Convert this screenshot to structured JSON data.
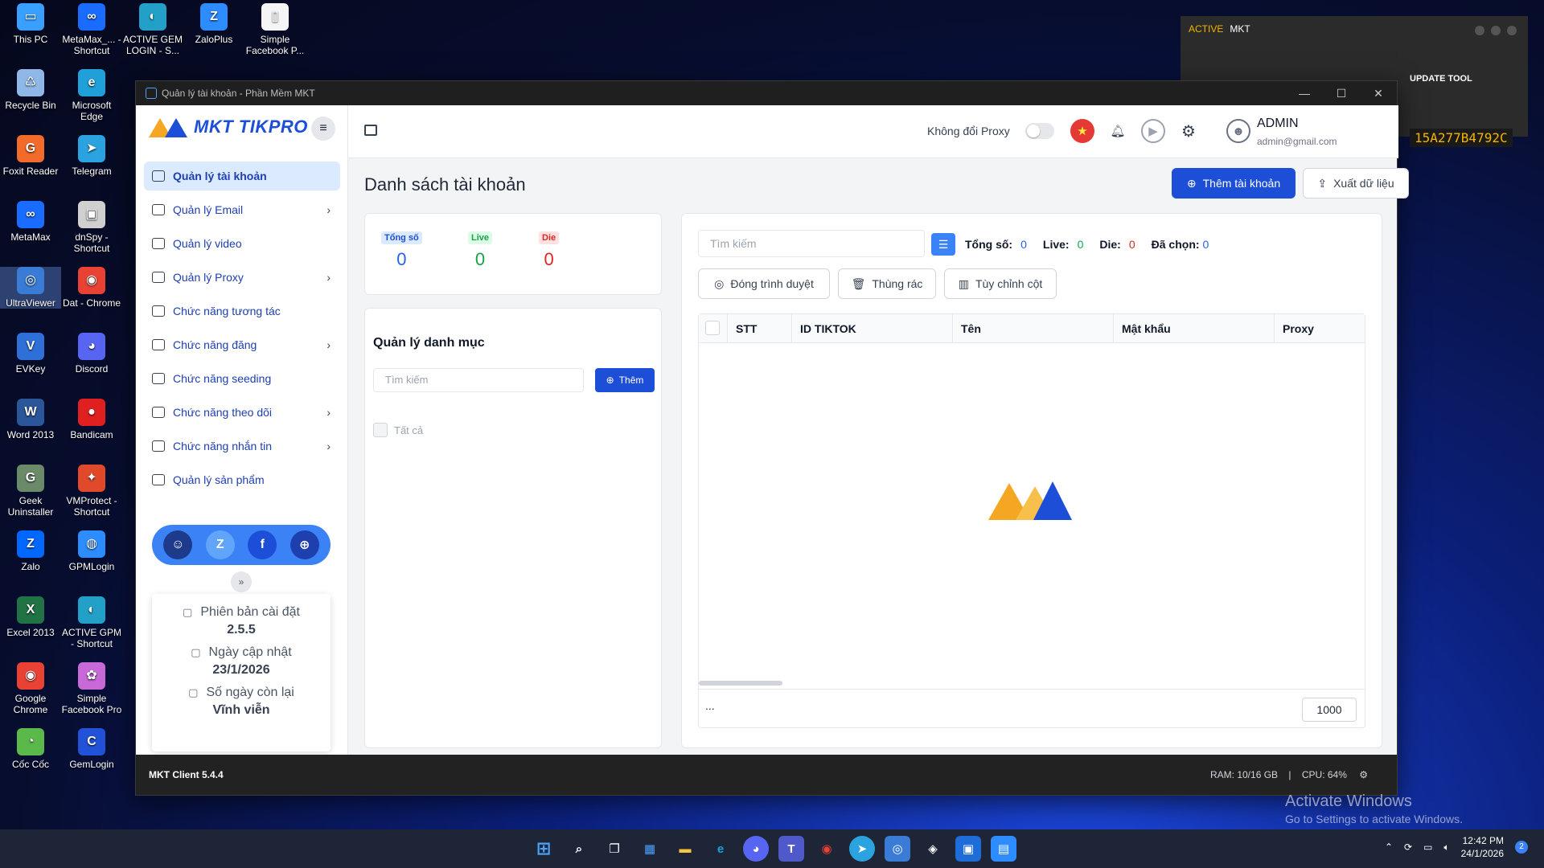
{
  "desktop_icons": [
    {
      "label": "This PC",
      "color": "#3aa0ff",
      "glyph": "▭"
    },
    {
      "label": "MetaMax_... - Shortcut",
      "color": "#1a6cff",
      "glyph": "∞"
    },
    {
      "label": "ACTIVE GEM LOGIN - S...",
      "color": "#22a0c8",
      "glyph": "◐"
    },
    {
      "label": "ZaloPlus",
      "color": "#2d8cff",
      "glyph": "Z"
    },
    {
      "label": "Simple Facebook P...",
      "color": "#f5f5f5",
      "glyph": "▯"
    },
    {
      "label": "Recycle Bin",
      "color": "#8fb8e8",
      "glyph": "♺"
    },
    {
      "label": "Microsoft Edge",
      "color": "#1fa0d8",
      "glyph": "e"
    },
    {
      "label": "Foxit Reader",
      "color": "#f26b2a",
      "glyph": "G"
    },
    {
      "label": "Telegram",
      "color": "#2aa3e0",
      "glyph": "➤"
    },
    {
      "label": "MetaMax",
      "color": "#1a6cff",
      "glyph": "∞"
    },
    {
      "label": "dnSpy - Shortcut",
      "color": "#d0d0d0",
      "glyph": "▣"
    },
    {
      "label": "UltraViewer",
      "color": "#3a7bd5",
      "glyph": "◎"
    },
    {
      "label": "Dat - Chrome",
      "color": "#e94235",
      "glyph": "◉"
    },
    {
      "label": "EVKey",
      "color": "#2f6fd8",
      "glyph": "V"
    },
    {
      "label": "Discord",
      "color": "#5865f2",
      "glyph": "◕"
    },
    {
      "label": "Word 2013",
      "color": "#2b579a",
      "glyph": "W"
    },
    {
      "label": "Bandicam",
      "color": "#e02020",
      "glyph": "●"
    },
    {
      "label": "Geek Uninstaller",
      "color": "#6a8a6a",
      "glyph": "G"
    },
    {
      "label": "VMProtect - Shortcut",
      "color": "#e04a2a",
      "glyph": "✦"
    },
    {
      "label": "Zalo",
      "color": "#0068ff",
      "glyph": "Z"
    },
    {
      "label": "GPMLogin",
      "color": "#2d8cff",
      "glyph": "◍"
    },
    {
      "label": "Excel 2013",
      "color": "#217346",
      "glyph": "X"
    },
    {
      "label": "ACTIVE GPM - Shortcut",
      "color": "#22a0c8",
      "glyph": "◐"
    },
    {
      "label": "Google Chrome",
      "color": "#e94235",
      "glyph": "◉"
    },
    {
      "label": "Simple Facebook Pro",
      "color": "#c76ad8",
      "glyph": "✿"
    },
    {
      "label": "Cốc Cốc",
      "color": "#5bb84a",
      "glyph": "◔"
    },
    {
      "label": "GemLogin",
      "color": "#2252d8",
      "glyph": "C"
    }
  ],
  "bg_window": {
    "active": "ACTIVE",
    "title": "MKT",
    "update": "UPDATE TOOL",
    "key": "15A277B4792C"
  },
  "window": {
    "title": "Quản lý tài khoản - Phần Mềm MKT",
    "minimize": "—",
    "maximize": "☐",
    "close": "✕"
  },
  "logo": {
    "text": "MKT TIKPRO",
    "colors": [
      "#f5a623",
      "#1d4ed8"
    ]
  },
  "sidebar": {
    "items": [
      {
        "label": "Quản lý tài khoản",
        "chevron": ""
      },
      {
        "label": "Quản lý Email",
        "chevron": "›"
      },
      {
        "label": "Quản lý video",
        "chevron": ""
      },
      {
        "label": "Quản lý Proxy",
        "chevron": "›"
      },
      {
        "label": "Chức năng tương tác",
        "chevron": ""
      },
      {
        "label": "Chức năng đăng",
        "chevron": "›"
      },
      {
        "label": "Chức năng seeding",
        "chevron": ""
      },
      {
        "label": "Chức năng theo dõi",
        "chevron": "›"
      },
      {
        "label": "Chức năng nhắn tin",
        "chevron": "›"
      },
      {
        "label": "Quản lý sản phẩm",
        "chevron": ""
      }
    ],
    "social": [
      {
        "icon": "support-icon",
        "glyph": "☺",
        "color": "#1e3a8a"
      },
      {
        "icon": "zalo-icon",
        "glyph": "Z",
        "color": "#60a5fa"
      },
      {
        "icon": "facebook-icon",
        "glyph": "f",
        "color": "#1d4ed8"
      },
      {
        "icon": "globe-icon",
        "glyph": "⊕",
        "color": "#1e40af"
      }
    ],
    "collapse": "»",
    "info": {
      "version_label": "Phiên bản cài đặt",
      "version": "2.5.5",
      "updated_label": "Ngày cập nhật",
      "updated": "23/1/2026",
      "days_label": "Số ngày còn lại",
      "days": "Vĩnh viễn"
    }
  },
  "topbar": {
    "proxy_label": "Không đổi Proxy",
    "user_name": "ADMIN",
    "user_email": "admin@gmail.com"
  },
  "page": {
    "title": "Danh sách tài khoản",
    "add_account": "Thêm tài khoản",
    "export": "Xuất dữ liệu"
  },
  "stats": {
    "total_label": "Tổng số",
    "total": "0",
    "live_label": "Live",
    "live": "0",
    "die_label": "Die",
    "die": "0"
  },
  "category": {
    "title": "Quản lý danh mục",
    "search_placeholder": "Tìm kiếm",
    "add": "Thêm",
    "all": "Tất cả"
  },
  "accounts": {
    "search_placeholder": "Tìm kiếm",
    "total_label": "Tổng số:",
    "total": "0",
    "live_label": "Live:",
    "live": "0",
    "die_label": "Die:",
    "die": "0",
    "selected_label": "Đã chọn:",
    "selected": "0",
    "close_browser": "Đóng trình duyệt",
    "trash": "Thùng rác",
    "customize_columns": "Tùy chỉnh cột",
    "columns": [
      "STT",
      "ID TIKTOK",
      "Tên",
      "Mật khẩu",
      "Proxy"
    ],
    "more": "...",
    "page_size": "1000"
  },
  "status": {
    "client": "MKT Client  5.4.4",
    "ram": "RAM: 10/16 GB",
    "cpu": "CPU: 64%"
  },
  "activate": {
    "line1": "Activate Windows",
    "line2": "Go to Settings to activate Windows."
  },
  "taskbar": {
    "time": "12:42 PM",
    "date": "24/1/2026",
    "notifications": "2"
  },
  "colors": {
    "primary": "#1d4ed8",
    "live": "#16a34a",
    "die": "#dc2626",
    "total": "#2563eb"
  }
}
